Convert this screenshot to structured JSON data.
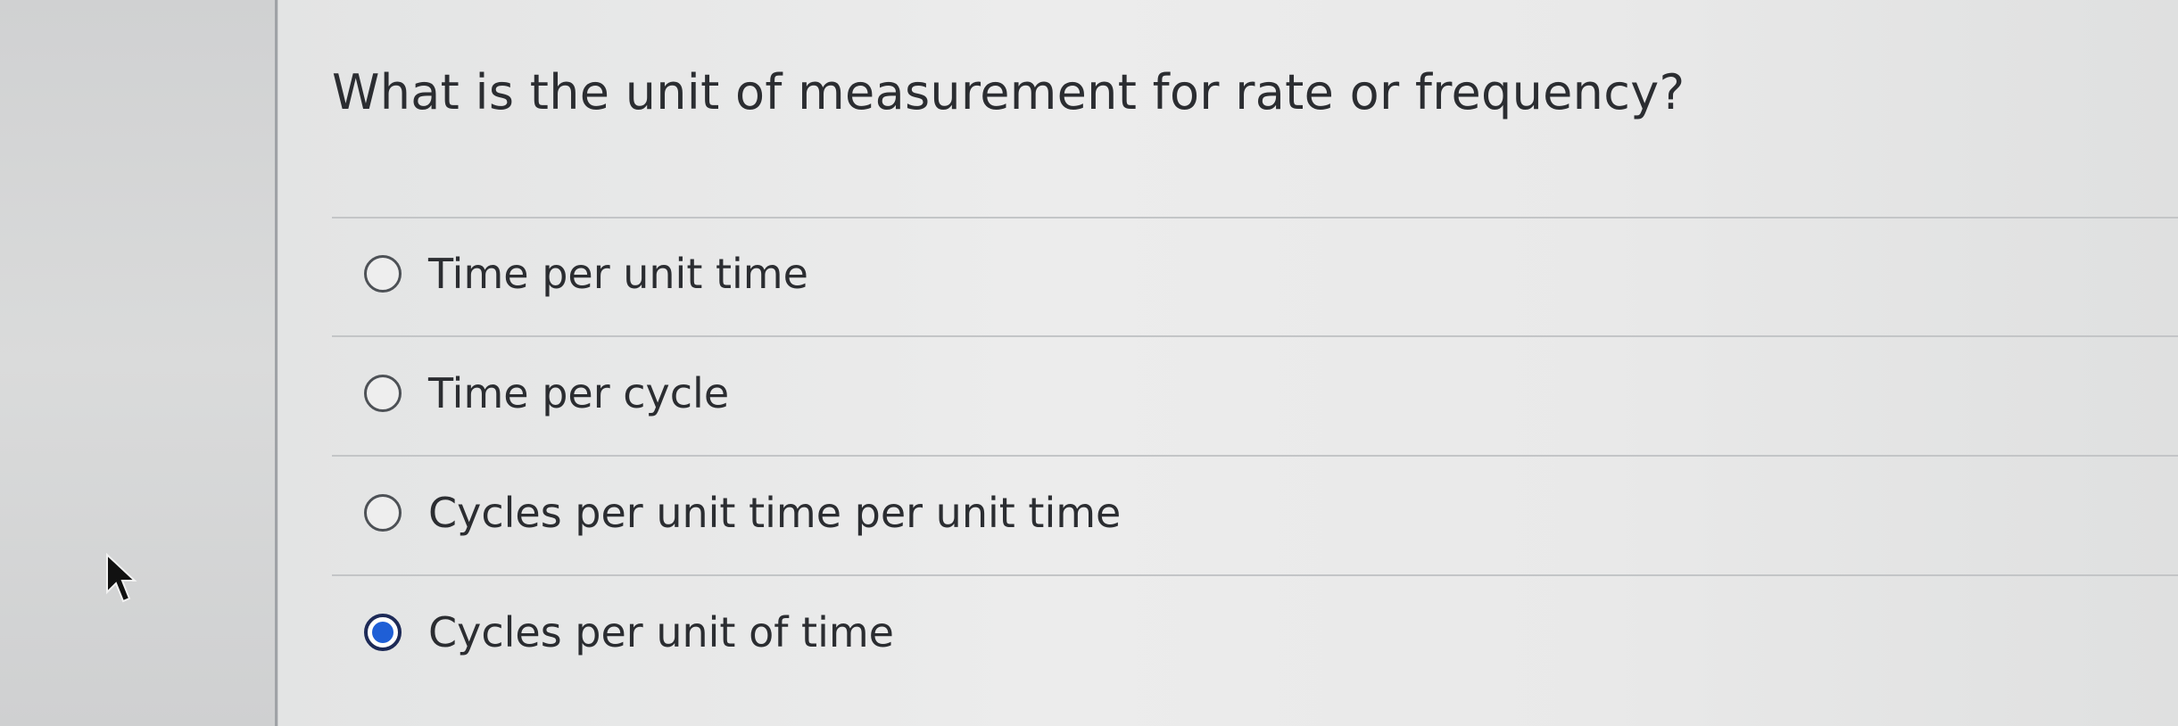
{
  "question": {
    "text": "What is the unit of measurement for rate or frequency?"
  },
  "answers": [
    {
      "label": "Time per unit time",
      "selected": false
    },
    {
      "label": "Time per cycle",
      "selected": false
    },
    {
      "label": "Cycles per unit time per unit time",
      "selected": false
    },
    {
      "label": "Cycles per unit of time",
      "selected": true
    }
  ],
  "colors": {
    "selected_fill": "#1f5fd6",
    "selected_ring": "#1d2a57",
    "text": "#2b2d31",
    "divider": "#c3c5c7"
  },
  "icons": {
    "pointer": "mouse-pointer-icon"
  }
}
